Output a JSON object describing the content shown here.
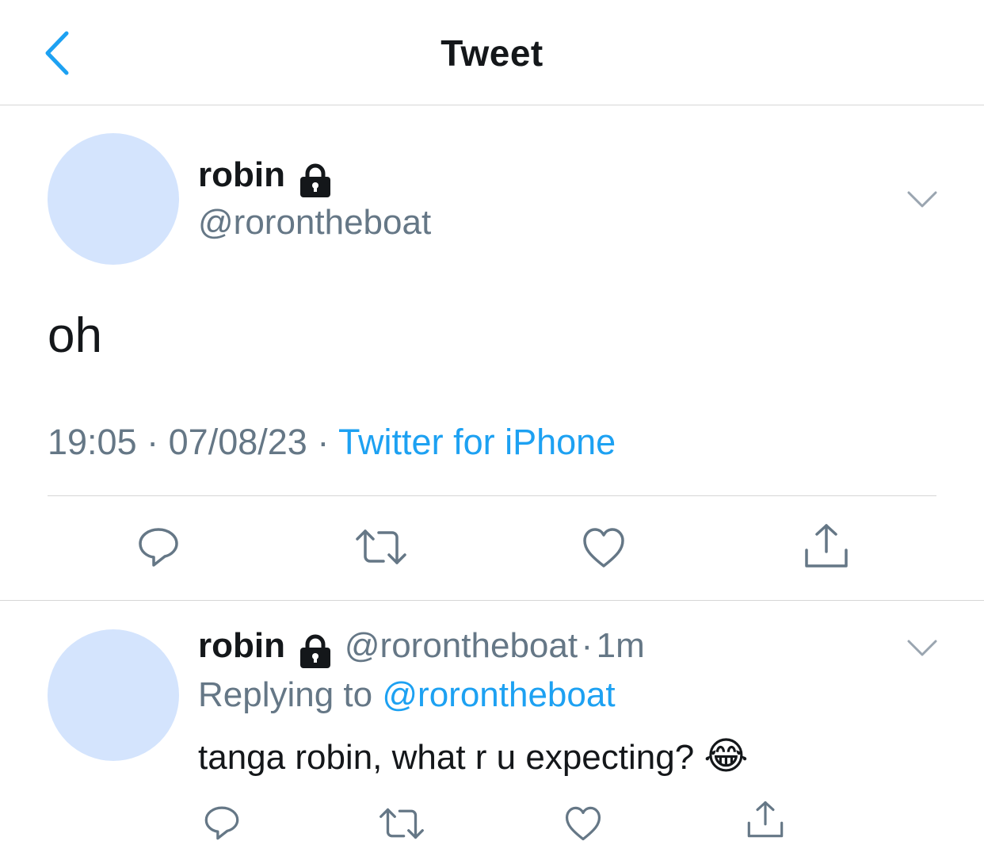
{
  "header": {
    "title": "Tweet"
  },
  "main_tweet": {
    "name": "robin",
    "handle": "@rorontheboat",
    "text": "oh",
    "time": "19:05",
    "date": "07/08/23",
    "sep": "·",
    "source": "Twitter for iPhone"
  },
  "reply": {
    "name": "robin",
    "handle": "@rorontheboat",
    "dot": "·",
    "age": "1m",
    "replying_prefix": "Replying to",
    "replying_handle": "@rorontheboat",
    "text": "tanga robin, what r u expecting?",
    "emoji": "😂"
  },
  "icons": {
    "back": "chevron-left-icon",
    "lock": "lock-icon",
    "more": "chevron-down-icon",
    "reply": "reply-icon",
    "retweet": "retweet-icon",
    "like": "heart-icon",
    "share": "share-icon"
  },
  "colors": {
    "accent": "#1da1f2",
    "muted": "#657786",
    "avatar": "#d4e4fd"
  }
}
